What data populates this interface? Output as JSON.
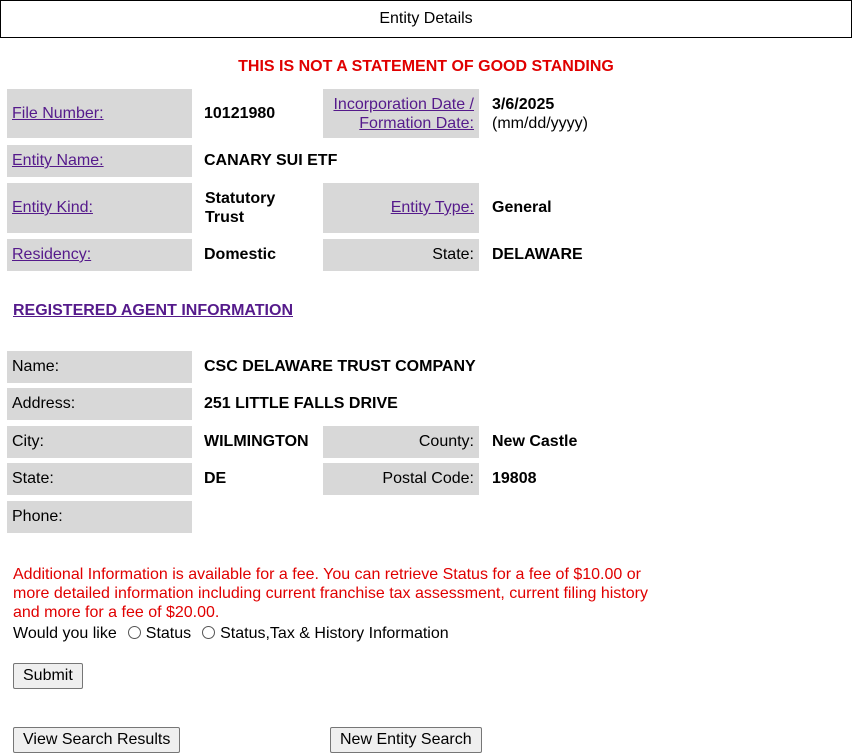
{
  "header": {
    "title": "Entity Details"
  },
  "warning": "THIS IS NOT A STATEMENT OF GOOD STANDING",
  "entity": {
    "file_number_label": "File Number:",
    "file_number": "10121980",
    "inc_date_label_1": "Incorporation Date /",
    "inc_date_label_2": "Formation Date:",
    "inc_date": "3/6/2025",
    "inc_date_format": "(mm/dd/yyyy)",
    "name_label": "Entity Name:",
    "name": "CANARY SUI ETF",
    "kind_label": "Entity Kind:",
    "kind_line1": "Statutory",
    "kind_line2": "Trust",
    "type_label": "Entity Type:",
    "type": "General",
    "residency_label": "Residency:",
    "residency": "Domestic",
    "state_label": "State:",
    "state": "DELAWARE"
  },
  "agent": {
    "section_title": "REGISTERED AGENT INFORMATION",
    "name_label": "Name:",
    "name": "CSC DELAWARE TRUST COMPANY",
    "address_label": "Address:",
    "address": "251 LITTLE FALLS DRIVE",
    "city_label": "City:",
    "city": "WILMINGTON",
    "county_label": "County:",
    "county": "New Castle",
    "state_label": "State:",
    "state": "DE",
    "postal_label": "Postal Code:",
    "postal": "19808",
    "phone_label": "Phone:",
    "phone": ""
  },
  "fee_info": "Additional Information is available for a fee. You can retrieve Status for a fee of $10.00 or more detailed information including current franchise tax assessment, current filing history and more for a fee of $20.00.",
  "question": {
    "prompt": "Would you like",
    "option1": "Status",
    "option2": "Status,Tax & History Information"
  },
  "buttons": {
    "submit": "Submit",
    "view_results": "View Search Results",
    "new_search": "New Entity Search"
  }
}
